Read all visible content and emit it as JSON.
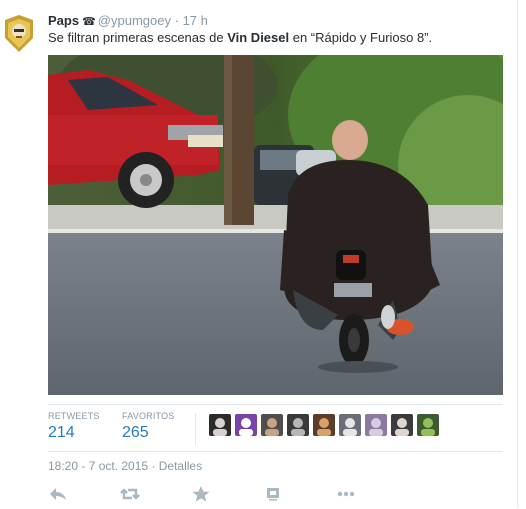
{
  "tweet": {
    "user_name": "Paps",
    "protected_glyph": "☎",
    "handle": "@ypumgoey",
    "separator": "·",
    "time_ago": "17 h",
    "text_before": "Se filtran primeras escenas de ",
    "text_bold": "Vin Diesel",
    "text_after": " en “Rápido y Furioso 8”.",
    "timestamp": "18:20 - 7 oct. 2015",
    "details_link": "Detalles"
  },
  "stats": {
    "retweets_label": "RETWEETS",
    "retweets_count": "214",
    "favorites_label": "FAVORITOS",
    "favorites_count": "265"
  },
  "favoriters": [
    {
      "name": "favoriter-1",
      "bg": "#2c2c2c",
      "fg": "#d9d1cf"
    },
    {
      "name": "favoriter-2",
      "bg": "#7a43a8",
      "fg": "#ffffff"
    },
    {
      "name": "favoriter-3",
      "bg": "#4e4e4e",
      "fg": "#c9a27f"
    },
    {
      "name": "favoriter-4",
      "bg": "#3a3a3a",
      "fg": "#b7b7b7"
    },
    {
      "name": "favoriter-5",
      "bg": "#5a3e2a",
      "fg": "#d7a36a"
    },
    {
      "name": "favoriter-6",
      "bg": "#6b6e7a",
      "fg": "#e6e6e6"
    },
    {
      "name": "favoriter-7",
      "bg": "#8a7aa0",
      "fg": "#d6cde0"
    },
    {
      "name": "favoriter-8",
      "bg": "#3b3b3b",
      "fg": "#e0d4d0"
    },
    {
      "name": "favoriter-9",
      "bg": "#3f5a2e",
      "fg": "#8fc05a"
    }
  ],
  "actions": [
    "reply-icon",
    "retweet-icon",
    "favorite-icon",
    "gallery-icon",
    "more-icon"
  ],
  "colors": {
    "link_blue": "#2b7bb9",
    "muted_gray": "#8899a6",
    "action_gray": "#aab8c2",
    "border": "#e1e8ed"
  }
}
